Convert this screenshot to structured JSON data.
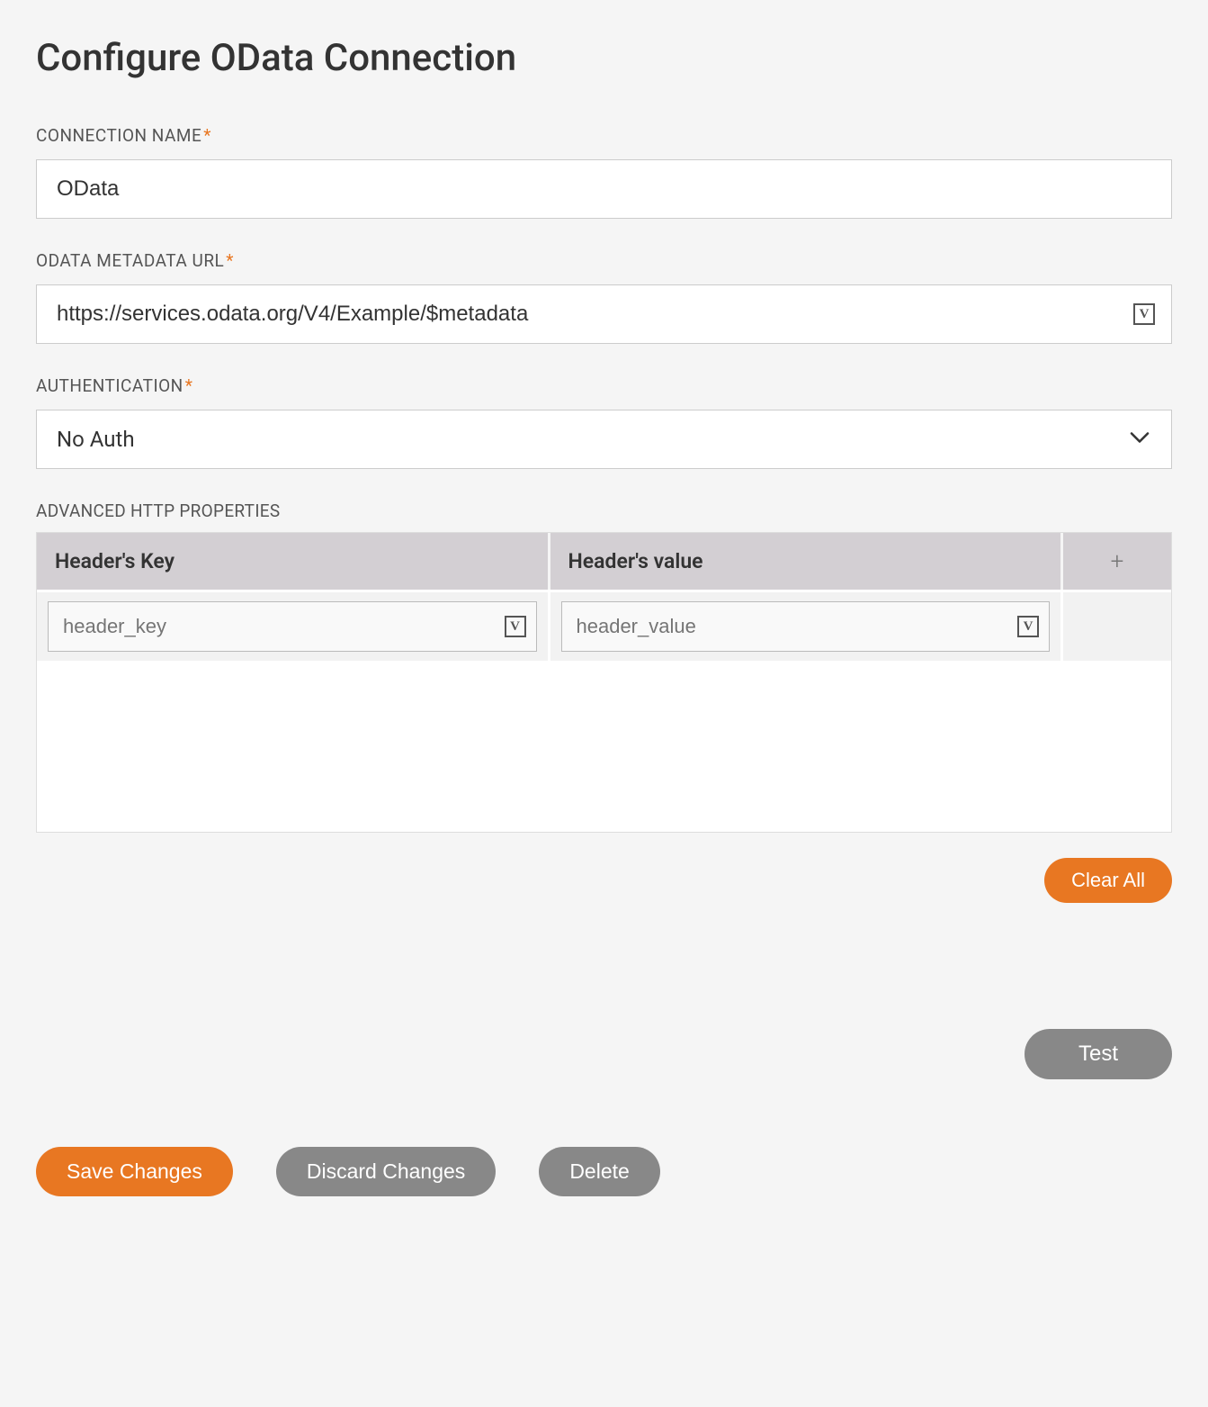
{
  "page": {
    "title": "Configure OData Connection"
  },
  "form": {
    "connection_name": {
      "label": "CONNECTION NAME",
      "required_marker": "*",
      "value": "OData"
    },
    "metadata_url": {
      "label": "ODATA METADATA URL",
      "required_marker": "*",
      "value": "https://services.odata.org/V4/Example/$metadata"
    },
    "authentication": {
      "label": "AUTHENTICATION",
      "required_marker": "*",
      "value": "No Auth"
    }
  },
  "advanced": {
    "section_label": "ADVANCED HTTP PROPERTIES",
    "columns": {
      "key": "Header's Key",
      "value": "Header's value"
    },
    "rows": [
      {
        "key_placeholder": "header_key",
        "value_placeholder": "header_value"
      }
    ],
    "add_icon": "+"
  },
  "icons": {
    "v_label": "V"
  },
  "buttons": {
    "clear_all": "Clear All",
    "test": "Test",
    "save": "Save Changes",
    "discard": "Discard Changes",
    "delete": "Delete"
  }
}
